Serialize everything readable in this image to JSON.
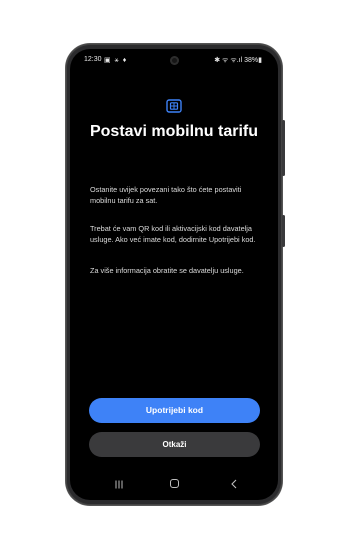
{
  "status_bar": {
    "time": "12:30",
    "left_icons": "▣ ⚹ ♦",
    "right_icons": "✱ ᯤ ᯤ.ıl 38%▮"
  },
  "sim_icon": "sim-card-icon",
  "title": "Postavi mobilnu tarifu",
  "paragraphs": {
    "p1": "Ostanite uvijek povezani tako što ćete postaviti mobilnu tarifu za sat.",
    "p2": "Trebat će vam QR kod ili aktivacijski kod davatelja usluge. Ako već imate kod, dodirnite Upotrijebi kod.",
    "p3": "Za više informacija obratite se davatelju usluge."
  },
  "buttons": {
    "use_code": "Upotrijebi kod",
    "cancel": "Otkaži"
  },
  "colors": {
    "accent": "#3e82f7",
    "secondary_button": "#3a3a3c",
    "background": "#000000"
  }
}
